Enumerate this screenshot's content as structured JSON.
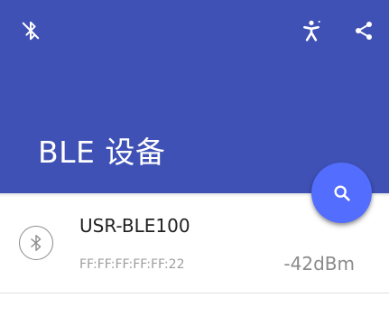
{
  "colors": {
    "app_bar": "#3f51b5",
    "fab": "#536dfe",
    "primary_text": "#212121",
    "secondary_text": "#9e9e9e"
  },
  "toolbar": {
    "left_icon": "bluetooth-disabled-icon",
    "right_icons": [
      "accessibility-icon",
      "share-icon"
    ]
  },
  "header": {
    "title": "BLE 设备"
  },
  "fab": {
    "icon": "search-icon"
  },
  "devices": [
    {
      "icon": "bluetooth-icon",
      "name": "USR-BLE100",
      "mac": "FF:FF:FF:FF:FF:22",
      "rssi": "-42dBm"
    }
  ]
}
